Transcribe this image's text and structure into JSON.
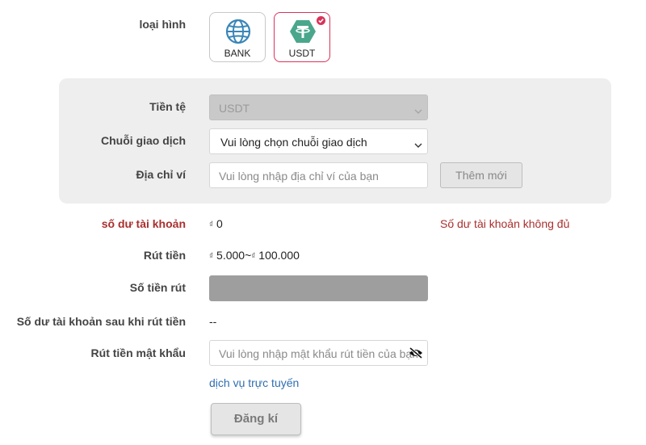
{
  "type_row": {
    "label": "loại hình",
    "options": [
      {
        "label": "BANK",
        "icon": "globe-icon",
        "selected": false
      },
      {
        "label": "USDT",
        "icon": "tether-icon",
        "selected": true
      }
    ]
  },
  "panel": {
    "currency": {
      "label": "Tiền tệ",
      "value": "USDT",
      "disabled": true
    },
    "chain": {
      "label": "Chuỗi giao dịch",
      "value": "Vui lòng chọn chuỗi giao dịch"
    },
    "wallet": {
      "label": "Địa chỉ ví",
      "placeholder": "Vui lòng nhập địa chỉ ví của bạn",
      "add_button": "Thêm mới"
    }
  },
  "balance": {
    "label": "số dư tài khoản",
    "currency_symbol": "₫",
    "value": "0",
    "warning": "Số dư tài khoản không đủ"
  },
  "withdraw_range": {
    "label": "Rút tiền",
    "symbol": "₫",
    "min": "5.000",
    "separator": "~",
    "max": "100.000"
  },
  "amount": {
    "label": "Số tiền rút"
  },
  "after_balance": {
    "label": "Số dư tài khoản sau khi rút tiền",
    "value": "--"
  },
  "password": {
    "label": "Rút tiền mật khẩu",
    "placeholder": "Vui lòng nhập mật khẩu rút tiền của bạn"
  },
  "support_link": "dịch vụ trực tuyến",
  "submit": "Đăng kí",
  "colors": {
    "accent": "#d9335a",
    "error": "#a8302f",
    "link": "#2f6eb0",
    "panel_bg": "#eeeeee",
    "tether": "#4aa78b",
    "bank": "#3a86b8"
  }
}
